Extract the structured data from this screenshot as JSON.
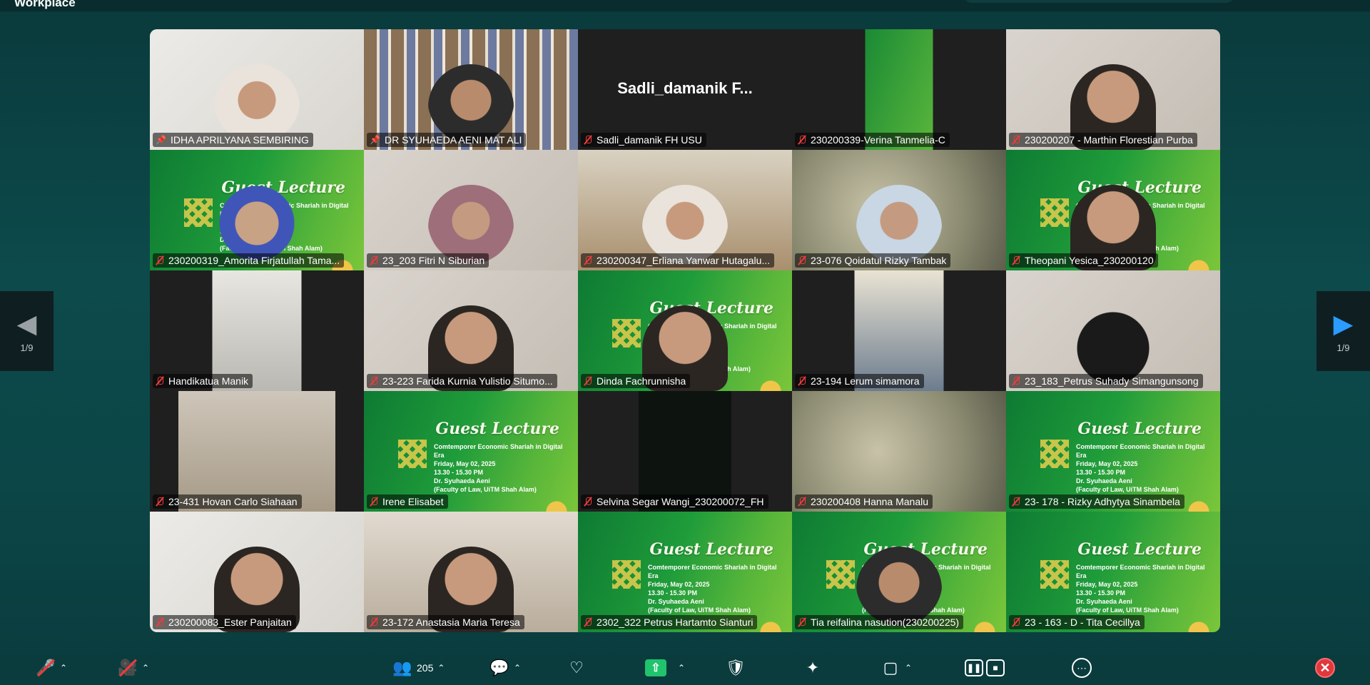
{
  "app": {
    "title": "Workplace"
  },
  "pagination": {
    "left": "1/9",
    "right": "1/9"
  },
  "poster": {
    "title": "Guest Lecture",
    "subtitle": "Comtemporer Economic Shariah in Digital Era",
    "date": "Friday, May 02, 2025",
    "time": "13.30 - 15.30 PM",
    "speaker": "Dr. Syuhaeda Aeni",
    "affiliation": "(Faculty of Law, UiTM Shah Alam)"
  },
  "participants": [
    {
      "name": "IDHA  APRILYANA  SEMBIRING",
      "status": "pinned",
      "video": "hijab-w"
    },
    {
      "name": "DR SYUHAEDA AENI MAT ALI",
      "status": "pinned",
      "video": "shelf"
    },
    {
      "name": "Sadli_damanik FH USU",
      "status": "muted",
      "video": "name",
      "display_name": "Sadli_damanik  F..."
    },
    {
      "name": "230200339-Verina Tanmelia-C",
      "status": "muted",
      "video": "narrow-green"
    },
    {
      "name": "230200207 - Marthin Florestian Purba",
      "status": "muted",
      "video": "skin"
    },
    {
      "name": "230200319_Amorita Firjatullah Tama...",
      "status": "muted",
      "video": "poster-blue"
    },
    {
      "name": "23_203 Fitri N Siburian",
      "status": "muted",
      "video": "light"
    },
    {
      "name": "230200347_Erliana Yanwar Hutagalu...",
      "status": "muted",
      "video": "room"
    },
    {
      "name": "23-076 Qoidatul Rizky Tambak",
      "status": "muted",
      "video": "blur-hijab"
    },
    {
      "name": "Theopani Yesica_230200120",
      "status": "muted",
      "video": "poster-person"
    },
    {
      "name": "Handikatua Manik",
      "status": "muted",
      "video": "narrow-white"
    },
    {
      "name": "23-223 Farida Kurnia Yulistio Situmo...",
      "status": "muted",
      "video": "light-face"
    },
    {
      "name": "Dinda Fachrunnisha",
      "status": "muted",
      "video": "poster-person"
    },
    {
      "name": "23-194 Lerum simamora",
      "status": "muted",
      "video": "narrow-bright"
    },
    {
      "name": "23_183_Petrus Suhady Simangunsong",
      "status": "muted",
      "video": "back"
    },
    {
      "name": "23-431 Hovan Carlo Siahaan",
      "status": "muted",
      "video": "narrow-room"
    },
    {
      "name": "Irene Elisabet",
      "status": "muted",
      "video": "poster"
    },
    {
      "name": "Selvina Segar Wangi_230200072_FH",
      "status": "muted",
      "video": "narrow-dark"
    },
    {
      "name": "230200408 Hanna Manalu",
      "status": "muted",
      "video": "blur"
    },
    {
      "name": "23- 178 - Rizky Adhytya Sinambela",
      "status": "muted",
      "video": "poster"
    },
    {
      "name": "230200083_Ester Panjaitan",
      "status": "muted",
      "video": "white-face"
    },
    {
      "name": "23-172 Anastasia Maria Teresa",
      "status": "muted",
      "video": "wall-face"
    },
    {
      "name": "2302_322 Petrus Hartamto Sianturi",
      "status": "muted",
      "video": "poster"
    },
    {
      "name": "Tia reifalina nasution(230200225)",
      "status": "muted",
      "video": "poster-hijab"
    },
    {
      "name": "23 - 163 - D - Tita Cecillya",
      "status": "muted",
      "video": "poster"
    }
  ],
  "toolbar": {
    "participants_count": "205"
  },
  "colors": {
    "accent": "#2fdc8a",
    "muted": "#ee3b3b",
    "share": "#1fc46c",
    "end": "#e0383c"
  }
}
